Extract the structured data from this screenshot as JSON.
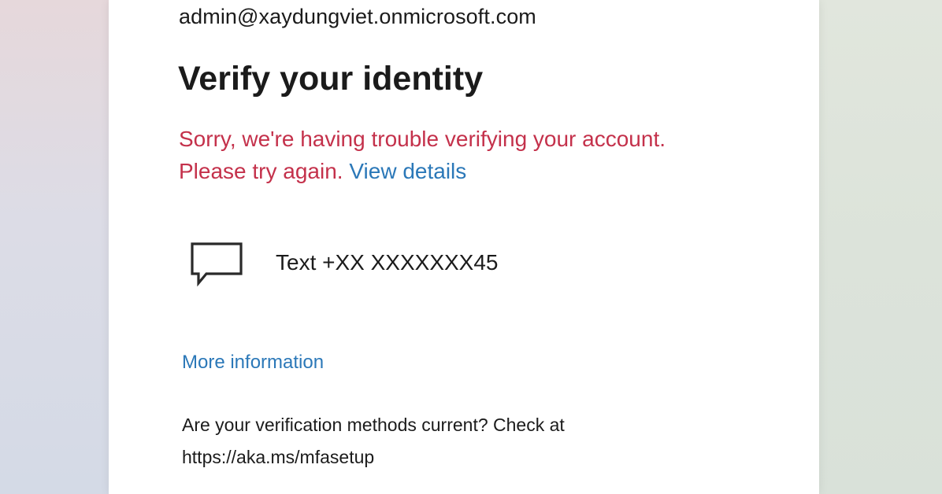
{
  "account": {
    "email": "admin@xaydungviet.onmicrosoft.com"
  },
  "page": {
    "title": "Verify your identity"
  },
  "error": {
    "line1": "Sorry, we're having trouble verifying your account.",
    "line2": "Please try again.",
    "details_link": "View details",
    "color": "#c4314b"
  },
  "method": {
    "icon": "message-bubble-icon",
    "label": "Text +XX XXXXXXX45"
  },
  "links": {
    "more_information": "More information",
    "color": "#2b78b8"
  },
  "footer": {
    "line1": "Are your verification methods current? Check at",
    "line2": "https://aka.ms/mfasetup"
  }
}
